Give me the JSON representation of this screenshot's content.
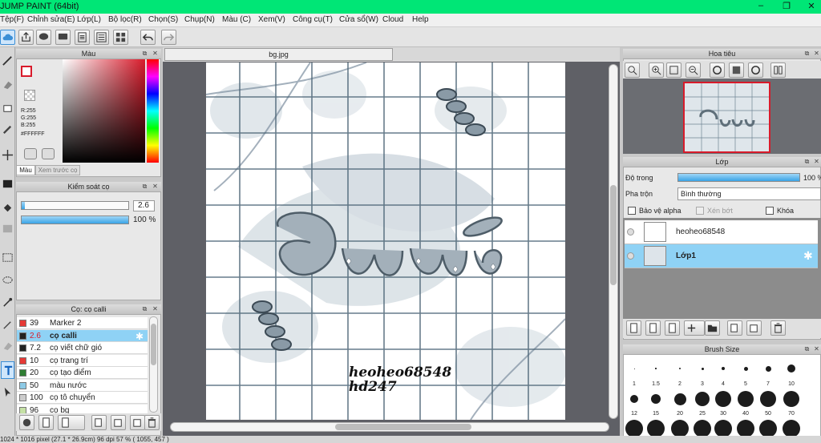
{
  "window": {
    "title": "JUMP PAINT (64bit)",
    "minimize": "–",
    "restore": "❐",
    "close": "✕"
  },
  "menu": [
    "Tệp(F)",
    "Chỉnh sửa(E)",
    "Lớp(L)",
    "Bộ lọc(R)",
    "Chọn(S)",
    "Chụp(N)",
    "Màu (C)",
    "Xem(V)",
    "Công cụ(T)",
    "Cửa sổ(W)",
    "Cloud",
    "Help"
  ],
  "canvas": {
    "tab": "bg.jpg",
    "signature_line1": "heoheo68548",
    "signature_line2": "hd247"
  },
  "color_panel": {
    "title": "Màu",
    "r": "R:255",
    "g": "G:255",
    "b": "B:255",
    "hex": "#FFFFFF",
    "tab_color": "Màu",
    "tab_preview": "Xem trước cọ",
    "colors": {
      "foreground": "#ffffff",
      "background": "#9a7ff0",
      "accent": "#d81b2b"
    }
  },
  "brush_control": {
    "title": "Kiểm soát cọ",
    "size": "2.6",
    "opacity": "100 %",
    "size_fraction": 0.03,
    "opacity_fraction": 1.0
  },
  "brush_list": {
    "title": "Cọ: cọ calli",
    "items": [
      {
        "size": "39",
        "name": "Marker 2",
        "color": "#e53935"
      },
      {
        "size": "2.6",
        "name": "cọ calli",
        "color": "#222222",
        "selected": true
      },
      {
        "size": "7.2",
        "name": "cọ viết chữ gió",
        "color": "#222222"
      },
      {
        "size": "10",
        "name": "cọ trang trí",
        "color": "#e53935"
      },
      {
        "size": "20",
        "name": "cọ tạo điểm",
        "color": "#2e7d32"
      },
      {
        "size": "50",
        "name": "màu nước",
        "color": "#8ecae6"
      },
      {
        "size": "100",
        "name": "cọ tô chuyển",
        "color": "#cccccc"
      },
      {
        "size": "96",
        "name": "cọ bg",
        "color": "#c5e1a5"
      }
    ]
  },
  "navigator": {
    "title": "Hoa tiêu"
  },
  "layers": {
    "title": "Lớp",
    "opacity_label": "Độ trong",
    "opacity_value": "100 %",
    "opacity_fraction": 1.0,
    "blend_label": "Pha trộn",
    "blend_value": "Bình thường",
    "protect_alpha": "Bảo vệ alpha",
    "clip": "Xén bớt",
    "lock": "Khóa",
    "items": [
      {
        "name": "heoheo68548",
        "selected": false
      },
      {
        "name": "Lớp1",
        "selected": true
      }
    ]
  },
  "brush_size": {
    "title": "Brush Size",
    "row1": [
      "1",
      "1.5",
      "2",
      "3",
      "4",
      "5",
      "7",
      "10"
    ],
    "row2": [
      "12",
      "15",
      "20",
      "25",
      "30",
      "40",
      "50",
      "70"
    ]
  },
  "status": {
    "text": "1024 * 1016 pixel   (27.1 * 26.9cm)   96 dpi   57 %   ( 1055, 457 )"
  }
}
